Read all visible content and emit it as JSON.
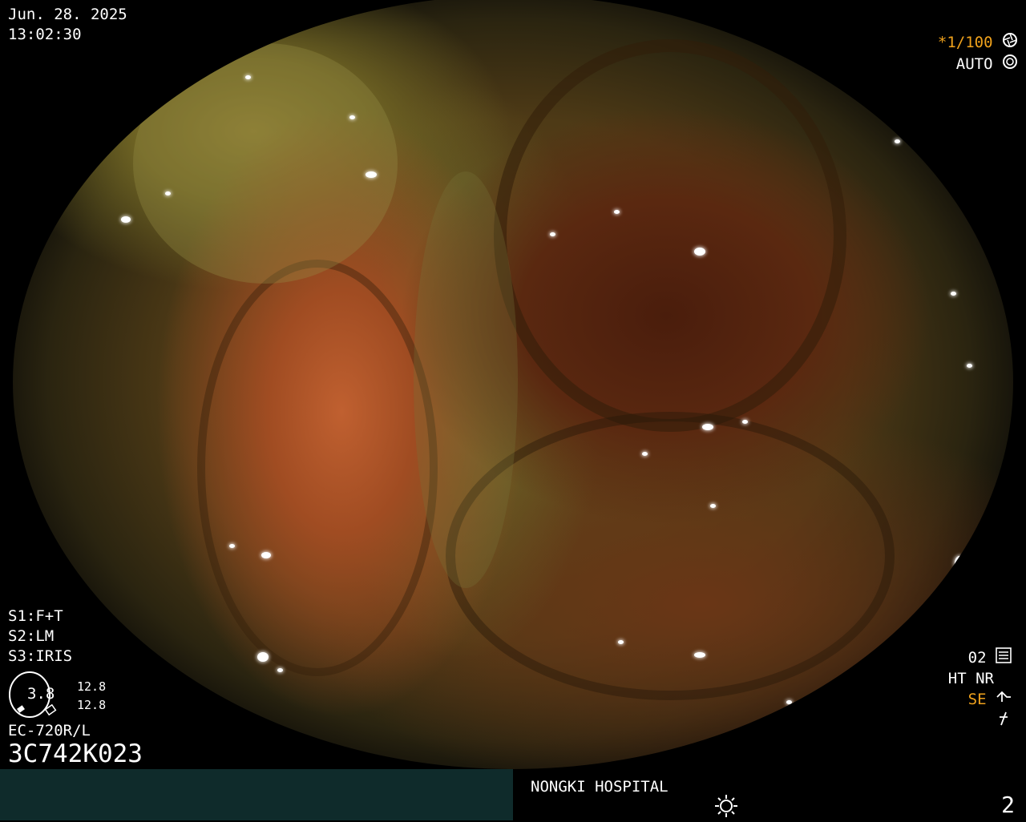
{
  "header": {
    "date": "Jun. 28. 2025",
    "time": "13:02:30"
  },
  "shutter": {
    "speed": "*1/100",
    "mode": "AUTO"
  },
  "settings": {
    "s1": "S1:F+T",
    "s2": "S2:LM",
    "s3": "S3:IRIS"
  },
  "gauge": {
    "value": "3.8",
    "upper": "12.8",
    "lower": "12.8"
  },
  "scope": {
    "model": "EC-720R/L",
    "serial": "3C742K023"
  },
  "status": {
    "mode_num": "02",
    "ht_nr": "HT NR",
    "se": "SE"
  },
  "footer": {
    "hospital": "NONGKI HOSPITAL",
    "page": "2"
  },
  "colors": {
    "accent": "#f0a21c",
    "bar_left": "#0f2b2b"
  },
  "icons": [
    "shutter-icon",
    "iris-icon",
    "mode-settings-icon",
    "structure-enhance-icon",
    "flash-off-icon",
    "brightness-icon"
  ]
}
